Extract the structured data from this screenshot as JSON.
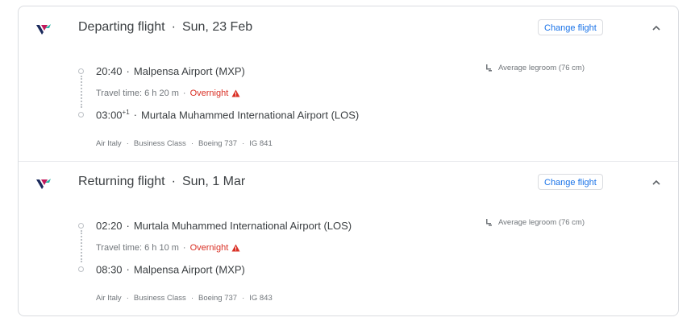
{
  "colors": {
    "accent": "#1a73e8",
    "overnight": "#d93025",
    "border": "#dadce0",
    "muted": "#70757a",
    "text": "#3c4043"
  },
  "flights": [
    {
      "heading": "Departing flight",
      "date": "Sun, 23 Feb",
      "change_label": "Change flight",
      "depart_time": "20:40",
      "depart_airport": "Malpensa Airport (MXP)",
      "travel_time": "Travel time: 6 h 20 m",
      "overnight_label": "Overnight",
      "arrive_time": "03:00",
      "arrive_day_offset": "+1",
      "arrive_airport": "Murtala Muhammed International Airport (LOS)",
      "airline": "Air Italy",
      "cabin": "Business Class",
      "aircraft": "Boeing 737",
      "flight_number": "IG 841",
      "legroom": "Average legroom (76 cm)"
    },
    {
      "heading": "Returning flight",
      "date": "Sun, 1 Mar",
      "change_label": "Change flight",
      "depart_time": "02:20",
      "depart_airport": "Murtala Muhammed International Airport (LOS)",
      "travel_time": "Travel time: 6 h 10 m",
      "overnight_label": "Overnight",
      "arrive_time": "08:30",
      "arrive_day_offset": "",
      "arrive_airport": "Malpensa Airport (MXP)",
      "airline": "Air Italy",
      "cabin": "Business Class",
      "aircraft": "Boeing 737",
      "flight_number": "IG 843",
      "legroom": "Average legroom (76 cm)"
    }
  ]
}
